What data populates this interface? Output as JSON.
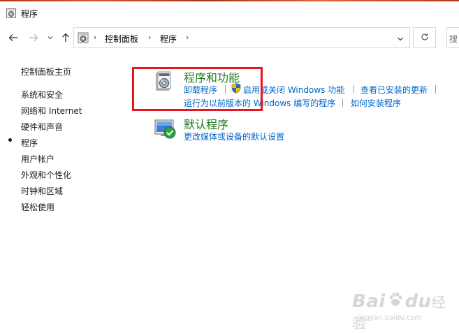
{
  "window": {
    "title": "程序"
  },
  "address": {
    "crumbs": [
      "控制面板",
      "程序"
    ],
    "search_placeholder": "搜"
  },
  "sidebar": {
    "home": "控制面板主页",
    "items": [
      "系统和安全",
      "网络和 Internet",
      "硬件和声音",
      "程序",
      "用户帐户",
      "外观和个性化",
      "时钟和区域",
      "轻松使用"
    ],
    "active": "程序"
  },
  "categories": {
    "programs": {
      "title": "程序和功能",
      "links": [
        "卸载程序",
        "启用或关闭 Windows 功能",
        "查看已安装的更新",
        "运行为以前版本的 Windows 编写的程序",
        "如何安装程序"
      ]
    },
    "defaults": {
      "title": "默认程序",
      "links": [
        "更改媒体或设备的默认设置"
      ]
    }
  },
  "watermark": {
    "brand": "Bai",
    "brand_suffix": "du",
    "cn": "经验",
    "url": "jingyan.baidu.com"
  },
  "colors": {
    "link": "#0066cc",
    "title_green": "#1e7a1e",
    "highlight": "#e8141e"
  }
}
